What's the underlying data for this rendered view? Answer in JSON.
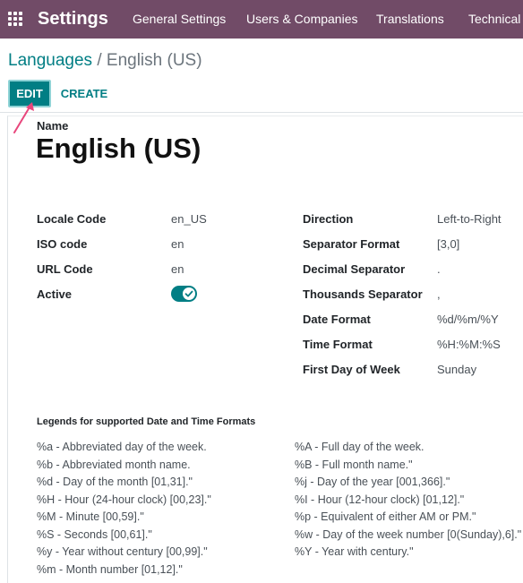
{
  "navbar": {
    "brand": "Settings",
    "menu": [
      "General Settings",
      "Users & Companies",
      "Translations",
      "Technical"
    ]
  },
  "breadcrumb": {
    "parent": "Languages",
    "separator": "/",
    "current": "English (US)"
  },
  "controls": {
    "edit_label": "EDIT",
    "create_label": "CREATE"
  },
  "form": {
    "name_label": "Name",
    "name_value": "English (US)",
    "left_fields": [
      {
        "label": "Locale Code",
        "value": "en_US"
      },
      {
        "label": "ISO code",
        "value": "en"
      },
      {
        "label": "URL Code",
        "value": "en"
      },
      {
        "label": "Active",
        "value": "true"
      }
    ],
    "right_fields": [
      {
        "label": "Direction",
        "value": "Left-to-Right"
      },
      {
        "label": "Separator Format",
        "value": "[3,0]"
      },
      {
        "label": "Decimal Separator",
        "value": "."
      },
      {
        "label": "Thousands Separator",
        "value": ","
      },
      {
        "label": "Date Format",
        "value": "%d/%m/%Y"
      },
      {
        "label": "Time Format",
        "value": "%H:%M:%S"
      },
      {
        "label": "First Day of Week",
        "value": "Sunday"
      }
    ]
  },
  "legends": {
    "title": "Legends for supported Date and Time Formats",
    "left": [
      "%a - Abbreviated day of the week.",
      "%b - Abbreviated month name.",
      "%d - Day of the month [01,31].\"",
      "%H - Hour (24-hour clock) [00,23].\"",
      "%M - Minute [00,59].\"",
      "%S - Seconds [00,61].\"",
      "%y - Year without century [00,99].\"",
      "%m - Month number [01,12].\""
    ],
    "right": [
      "%A - Full day of the week.",
      "%B - Full month name.\"",
      "%j - Day of the year [001,366].\"",
      "%I - Hour (12-hour clock) [01,12].\"",
      "%p - Equivalent of either AM or PM.\"",
      "%w - Day of the week number [0(Sunday),6].\"",
      "%Y - Year with century.\""
    ]
  },
  "colors": {
    "navbar": "#714B67",
    "primary": "#017E84",
    "arrow": "#E8467C"
  }
}
